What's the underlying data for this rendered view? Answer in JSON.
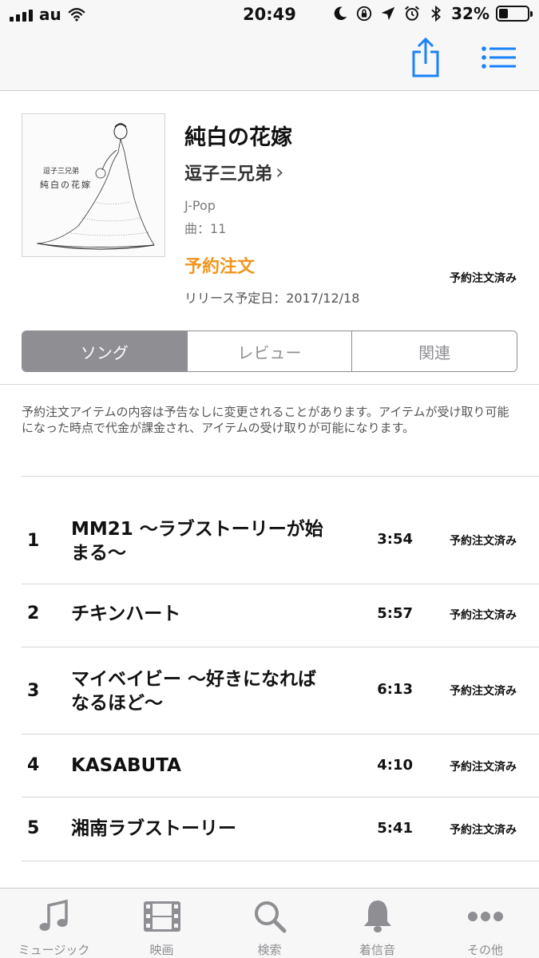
{
  "status_bar": {
    "carrier": "au",
    "time": "20:49",
    "battery_percent": "32%",
    "battery_level": 0.32,
    "icons": [
      "signal-icon",
      "wifi-icon",
      "moon-icon",
      "rotation-lock-icon",
      "location-icon",
      "alarm-icon",
      "bluetooth-icon",
      "battery-icon"
    ]
  },
  "nav": {
    "icons": [
      "share-icon",
      "list-icon"
    ],
    "accent_color": "#1a82fb"
  },
  "album": {
    "title": "純白の花嫁",
    "artist": "逗子三兄弟",
    "artist_chevron": "›",
    "genre": "J-Pop",
    "track_count": "曲：11",
    "preorder_label": "予約注文",
    "release_date": "リリース予定日：2017/12/18",
    "preordered_status": "予約注文済み",
    "art_text": [
      "逗子三兄弟",
      "純白の花嫁"
    ]
  },
  "segments": [
    "ソング",
    "レビュー",
    "関連"
  ],
  "notice": "予約注文アイテムの内容は予告なしに変更されることがあります。アイテムが受け取り可能になった時点で代金が課金され、アイテムの受け取りが可能になります。",
  "tracks": [
    {
      "number": "1",
      "name": "MM21 〜ラブストーリーが始まる〜",
      "duration": "3:54",
      "status": "予約注文済み"
    },
    {
      "number": "2",
      "name": "チキンハート",
      "duration": "5:57",
      "status": "予約注文済み"
    },
    {
      "number": "3",
      "name": "マイベイビー 〜好きになればなるほど〜",
      "duration": "6:13",
      "status": "予約注文済み"
    },
    {
      "number": "4",
      "name": "KASABUTA",
      "duration": "4:10",
      "status": "予約注文済み"
    },
    {
      "number": "5",
      "name": "湘南ラブストーリー",
      "duration": "5:41",
      "status": "予約注文済み"
    }
  ],
  "tab_bar": [
    {
      "label": "ミュージック",
      "icon": "music-note-icon"
    },
    {
      "label": "映画",
      "icon": "film-icon"
    },
    {
      "label": "検索",
      "icon": "search-icon"
    },
    {
      "label": "着信音",
      "icon": "bell-icon"
    },
    {
      "label": "その他",
      "icon": "more-icon"
    }
  ],
  "colors": {
    "orange": "#f0961e",
    "gray": "#8e8e93",
    "accent": "#1a82fb"
  }
}
